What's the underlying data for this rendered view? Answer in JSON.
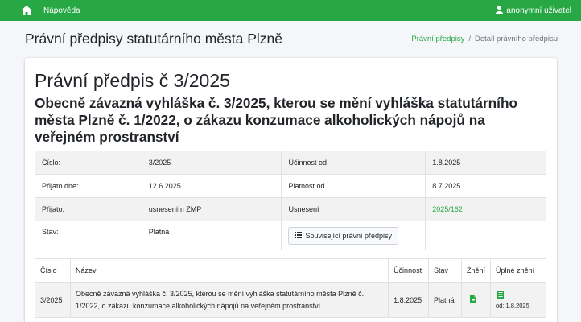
{
  "nav": {
    "help_label": "Nápověda",
    "user_label": "anonymní uživatel"
  },
  "header": {
    "title": "Právní předpisy statutárního města Plzně",
    "breadcrumb": {
      "link": "Právní předpisy",
      "separator": "/",
      "current": "Detail právního předpisu"
    }
  },
  "document": {
    "title": "Právní předpis č 3/2025",
    "subtitle": "Obecně závazná vyhláška č. 3/2025, kterou se mění vyhláška statutárního města Plzně č. 1/2022, o zákazu konzumace alkoholických nápojů na veřejném prostranství"
  },
  "info": {
    "cislo_label": "Číslo:",
    "cislo_value": "3/2025",
    "ucinnost_label": "Účinnost od",
    "ucinnost_value": "1.8.2025",
    "prijato_dne_label": "Přijato dne:",
    "prijato_dne_value": "12.6.2025",
    "platnost_label": "Platnost od",
    "platnost_value": "8.7.2025",
    "prijato_label": "Přijato:",
    "prijato_value": "usnesením ZMP",
    "usneseni_label": "Usnesení",
    "usneseni_value": "2025/162",
    "stav_label": "Stav:",
    "stav_value": "Platná",
    "related_button": "Související právní předpisy"
  },
  "list": {
    "headers": {
      "cislo": "Číslo",
      "nazev": "Název",
      "ucinnost": "Účinnost",
      "stav": "Stav",
      "zneni": "Znění",
      "uplne": "Úplné znění"
    },
    "rows": [
      {
        "cislo": "3/2025",
        "nazev": "Obecně závazná vyhláška č. 3/2025, kterou se mění vyhláška statutárního města Plzně č. 1/2022, o zákazu konzumace alkoholických nápojů na veřejném prostranství",
        "ucinnost": "1.8.2025",
        "stav": "Platná",
        "zneni_icon": "pdf-file-icon",
        "uplne_icon": "document-file-icon",
        "uplne_od": "od: 1.8.2025"
      }
    ]
  },
  "colors": {
    "brand": "#28a745",
    "background": "#f4f6f9"
  }
}
